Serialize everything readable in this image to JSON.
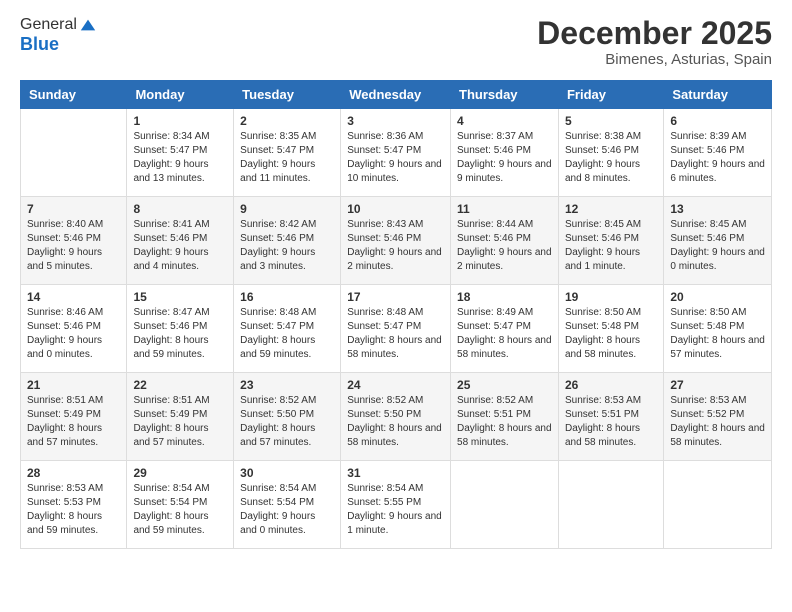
{
  "header": {
    "logo_general": "General",
    "logo_blue": "Blue",
    "month_title": "December 2025",
    "location": "Bimenes, Asturias, Spain"
  },
  "weekdays": [
    "Sunday",
    "Monday",
    "Tuesday",
    "Wednesday",
    "Thursday",
    "Friday",
    "Saturday"
  ],
  "weeks": [
    [
      {
        "day": "",
        "sunrise": "",
        "sunset": "",
        "daylight": ""
      },
      {
        "day": "1",
        "sunrise": "Sunrise: 8:34 AM",
        "sunset": "Sunset: 5:47 PM",
        "daylight": "Daylight: 9 hours and 13 minutes."
      },
      {
        "day": "2",
        "sunrise": "Sunrise: 8:35 AM",
        "sunset": "Sunset: 5:47 PM",
        "daylight": "Daylight: 9 hours and 11 minutes."
      },
      {
        "day": "3",
        "sunrise": "Sunrise: 8:36 AM",
        "sunset": "Sunset: 5:47 PM",
        "daylight": "Daylight: 9 hours and 10 minutes."
      },
      {
        "day": "4",
        "sunrise": "Sunrise: 8:37 AM",
        "sunset": "Sunset: 5:46 PM",
        "daylight": "Daylight: 9 hours and 9 minutes."
      },
      {
        "day": "5",
        "sunrise": "Sunrise: 8:38 AM",
        "sunset": "Sunset: 5:46 PM",
        "daylight": "Daylight: 9 hours and 8 minutes."
      },
      {
        "day": "6",
        "sunrise": "Sunrise: 8:39 AM",
        "sunset": "Sunset: 5:46 PM",
        "daylight": "Daylight: 9 hours and 6 minutes."
      }
    ],
    [
      {
        "day": "7",
        "sunrise": "Sunrise: 8:40 AM",
        "sunset": "Sunset: 5:46 PM",
        "daylight": "Daylight: 9 hours and 5 minutes."
      },
      {
        "day": "8",
        "sunrise": "Sunrise: 8:41 AM",
        "sunset": "Sunset: 5:46 PM",
        "daylight": "Daylight: 9 hours and 4 minutes."
      },
      {
        "day": "9",
        "sunrise": "Sunrise: 8:42 AM",
        "sunset": "Sunset: 5:46 PM",
        "daylight": "Daylight: 9 hours and 3 minutes."
      },
      {
        "day": "10",
        "sunrise": "Sunrise: 8:43 AM",
        "sunset": "Sunset: 5:46 PM",
        "daylight": "Daylight: 9 hours and 2 minutes."
      },
      {
        "day": "11",
        "sunrise": "Sunrise: 8:44 AM",
        "sunset": "Sunset: 5:46 PM",
        "daylight": "Daylight: 9 hours and 2 minutes."
      },
      {
        "day": "12",
        "sunrise": "Sunrise: 8:45 AM",
        "sunset": "Sunset: 5:46 PM",
        "daylight": "Daylight: 9 hours and 1 minute."
      },
      {
        "day": "13",
        "sunrise": "Sunrise: 8:45 AM",
        "sunset": "Sunset: 5:46 PM",
        "daylight": "Daylight: 9 hours and 0 minutes."
      }
    ],
    [
      {
        "day": "14",
        "sunrise": "Sunrise: 8:46 AM",
        "sunset": "Sunset: 5:46 PM",
        "daylight": "Daylight: 9 hours and 0 minutes."
      },
      {
        "day": "15",
        "sunrise": "Sunrise: 8:47 AM",
        "sunset": "Sunset: 5:46 PM",
        "daylight": "Daylight: 8 hours and 59 minutes."
      },
      {
        "day": "16",
        "sunrise": "Sunrise: 8:48 AM",
        "sunset": "Sunset: 5:47 PM",
        "daylight": "Daylight: 8 hours and 59 minutes."
      },
      {
        "day": "17",
        "sunrise": "Sunrise: 8:48 AM",
        "sunset": "Sunset: 5:47 PM",
        "daylight": "Daylight: 8 hours and 58 minutes."
      },
      {
        "day": "18",
        "sunrise": "Sunrise: 8:49 AM",
        "sunset": "Sunset: 5:47 PM",
        "daylight": "Daylight: 8 hours and 58 minutes."
      },
      {
        "day": "19",
        "sunrise": "Sunrise: 8:50 AM",
        "sunset": "Sunset: 5:48 PM",
        "daylight": "Daylight: 8 hours and 58 minutes."
      },
      {
        "day": "20",
        "sunrise": "Sunrise: 8:50 AM",
        "sunset": "Sunset: 5:48 PM",
        "daylight": "Daylight: 8 hours and 57 minutes."
      }
    ],
    [
      {
        "day": "21",
        "sunrise": "Sunrise: 8:51 AM",
        "sunset": "Sunset: 5:49 PM",
        "daylight": "Daylight: 8 hours and 57 minutes."
      },
      {
        "day": "22",
        "sunrise": "Sunrise: 8:51 AM",
        "sunset": "Sunset: 5:49 PM",
        "daylight": "Daylight: 8 hours and 57 minutes."
      },
      {
        "day": "23",
        "sunrise": "Sunrise: 8:52 AM",
        "sunset": "Sunset: 5:50 PM",
        "daylight": "Daylight: 8 hours and 57 minutes."
      },
      {
        "day": "24",
        "sunrise": "Sunrise: 8:52 AM",
        "sunset": "Sunset: 5:50 PM",
        "daylight": "Daylight: 8 hours and 58 minutes."
      },
      {
        "day": "25",
        "sunrise": "Sunrise: 8:52 AM",
        "sunset": "Sunset: 5:51 PM",
        "daylight": "Daylight: 8 hours and 58 minutes."
      },
      {
        "day": "26",
        "sunrise": "Sunrise: 8:53 AM",
        "sunset": "Sunset: 5:51 PM",
        "daylight": "Daylight: 8 hours and 58 minutes."
      },
      {
        "day": "27",
        "sunrise": "Sunrise: 8:53 AM",
        "sunset": "Sunset: 5:52 PM",
        "daylight": "Daylight: 8 hours and 58 minutes."
      }
    ],
    [
      {
        "day": "28",
        "sunrise": "Sunrise: 8:53 AM",
        "sunset": "Sunset: 5:53 PM",
        "daylight": "Daylight: 8 hours and 59 minutes."
      },
      {
        "day": "29",
        "sunrise": "Sunrise: 8:54 AM",
        "sunset": "Sunset: 5:54 PM",
        "daylight": "Daylight: 8 hours and 59 minutes."
      },
      {
        "day": "30",
        "sunrise": "Sunrise: 8:54 AM",
        "sunset": "Sunset: 5:54 PM",
        "daylight": "Daylight: 9 hours and 0 minutes."
      },
      {
        "day": "31",
        "sunrise": "Sunrise: 8:54 AM",
        "sunset": "Sunset: 5:55 PM",
        "daylight": "Daylight: 9 hours and 1 minute."
      },
      {
        "day": "",
        "sunrise": "",
        "sunset": "",
        "daylight": ""
      },
      {
        "day": "",
        "sunrise": "",
        "sunset": "",
        "daylight": ""
      },
      {
        "day": "",
        "sunrise": "",
        "sunset": "",
        "daylight": ""
      }
    ]
  ]
}
